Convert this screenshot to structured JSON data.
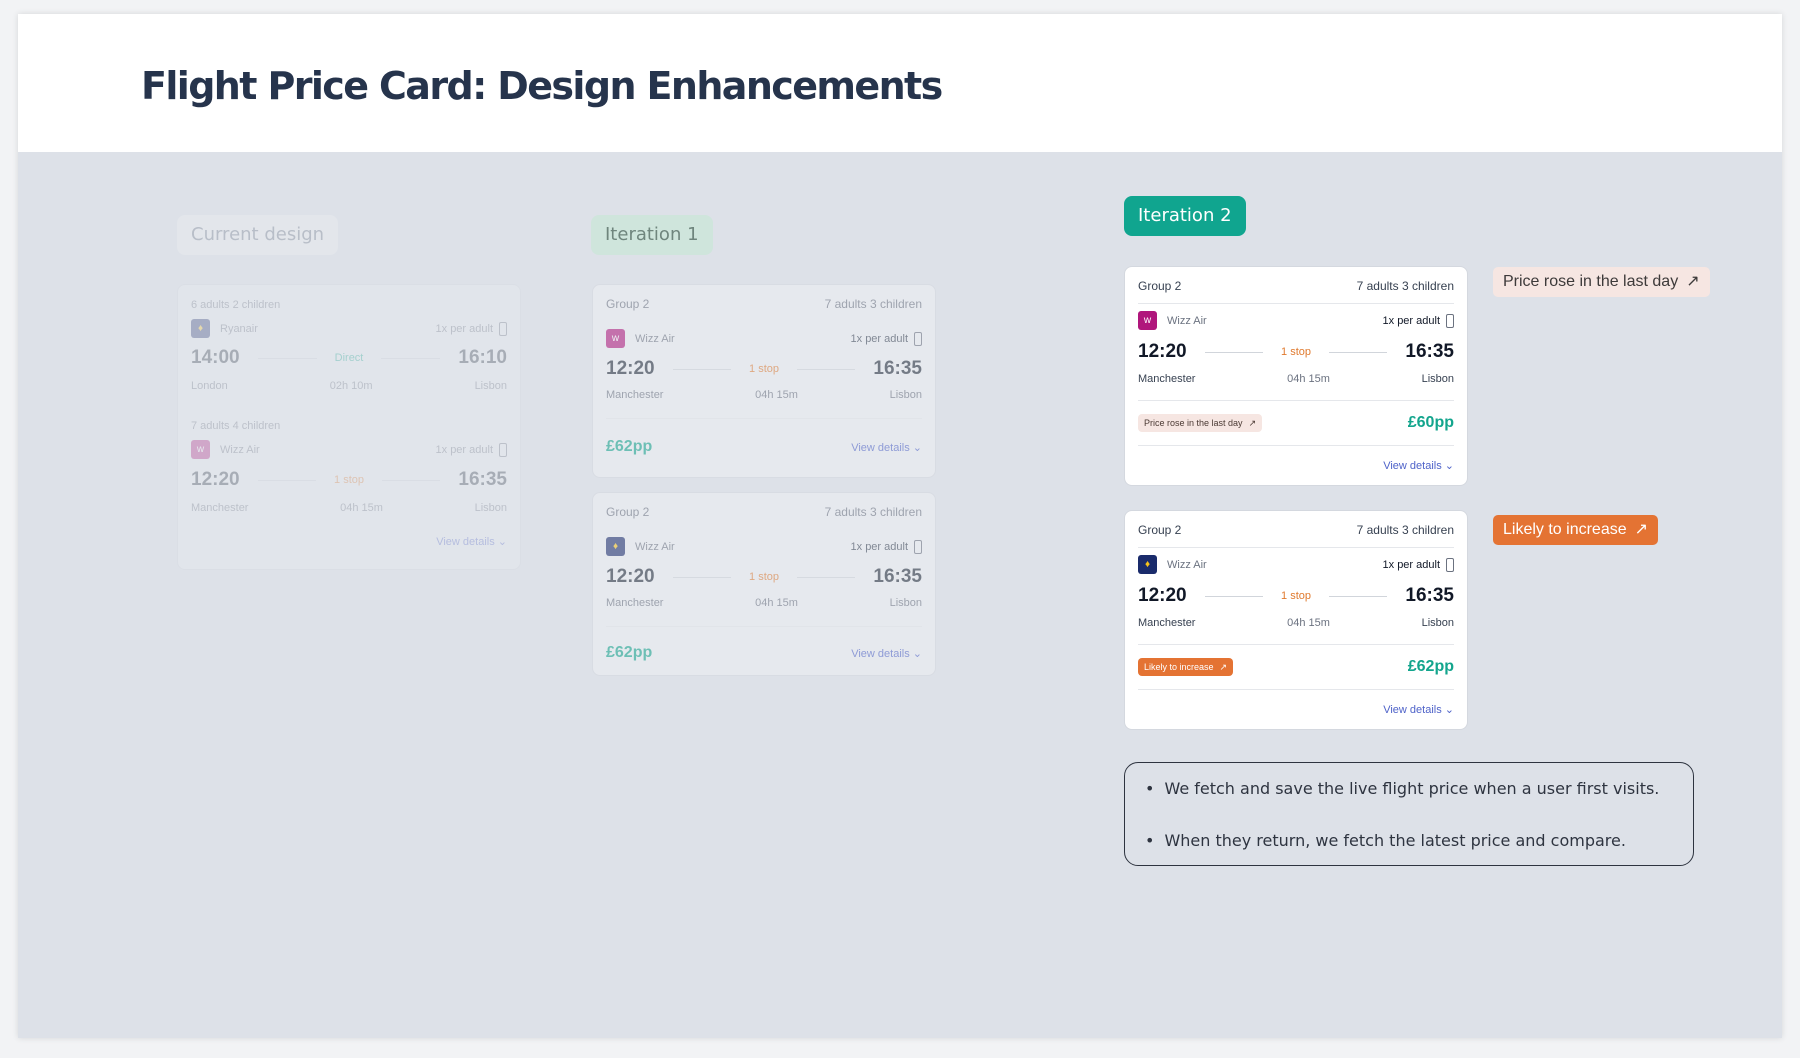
{
  "title": "Flight Price Card: Design Enhancements",
  "labels": {
    "current": "Current design",
    "iter1": "Iteration 1",
    "iter2": "Iteration 2"
  },
  "current_card": {
    "seg1": {
      "pax": "6 adults 2 children",
      "airline": "Ryanair",
      "bag": "1x per adult",
      "dep": "14:00",
      "stop": "Direct",
      "arr": "16:10",
      "from": "London",
      "dur": "02h 10m",
      "to": "Lisbon"
    },
    "seg2": {
      "pax": "7 adults 4 children",
      "airline": "Wizz Air",
      "bag": "1x per adult",
      "dep": "12:20",
      "stop": "1 stop",
      "arr": "16:35",
      "from": "Manchester",
      "dur": "04h 15m",
      "to": "Lisbon"
    },
    "view": "View details"
  },
  "iter1_cards": [
    {
      "group": "Group 2",
      "pax": "7 adults 3 children",
      "airline": "Wizz Air",
      "bag": "1x per adult",
      "dep": "12:20",
      "stop": "1 stop",
      "arr": "16:35",
      "from": "Manchester",
      "dur": "04h 15m",
      "to": "Lisbon",
      "price": "£62pp",
      "view": "View details"
    },
    {
      "group": "Group 2",
      "pax": "7 adults 3 children",
      "airline": "Wizz Air",
      "bag": "1x per adult",
      "dep": "12:20",
      "stop": "1 stop",
      "arr": "16:35",
      "from": "Manchester",
      "dur": "04h 15m",
      "to": "Lisbon",
      "price": "£62pp",
      "view": "View details"
    }
  ],
  "iter2_cards": [
    {
      "group": "Group 2",
      "pax": "7 adults 3 children",
      "airline": "Wizz Air",
      "bag": "1x per adult",
      "dep": "12:20",
      "stop": "1 stop",
      "arr": "16:35",
      "from": "Manchester",
      "dur": "04h 15m",
      "to": "Lisbon",
      "chip": "Price rose in the last day",
      "price": "£60pp",
      "view": "View details"
    },
    {
      "group": "Group 2",
      "pax": "7 adults 3 children",
      "airline": "Wizz Air",
      "bag": "1x per adult",
      "dep": "12:20",
      "stop": "1 stop",
      "arr": "16:35",
      "from": "Manchester",
      "dur": "04h 15m",
      "to": "Lisbon",
      "chip": "Likely to increase",
      "price": "£62pp",
      "view": "View details"
    }
  ],
  "side_badges": {
    "rose": "Price rose in the last day",
    "increase": "Likely to increase"
  },
  "notes": [
    "We fetch and save the live flight price when a user first visits.",
    "When they return, we fetch the latest price and compare."
  ],
  "colors": {
    "teal": "#13a58d",
    "orange": "#e47333",
    "link": "#4f63c9",
    "rose_bg": "#f6e6e2"
  },
  "icons": [
    "trend-up-icon",
    "chevron-down-icon",
    "luggage-icon",
    "airline-logo"
  ]
}
